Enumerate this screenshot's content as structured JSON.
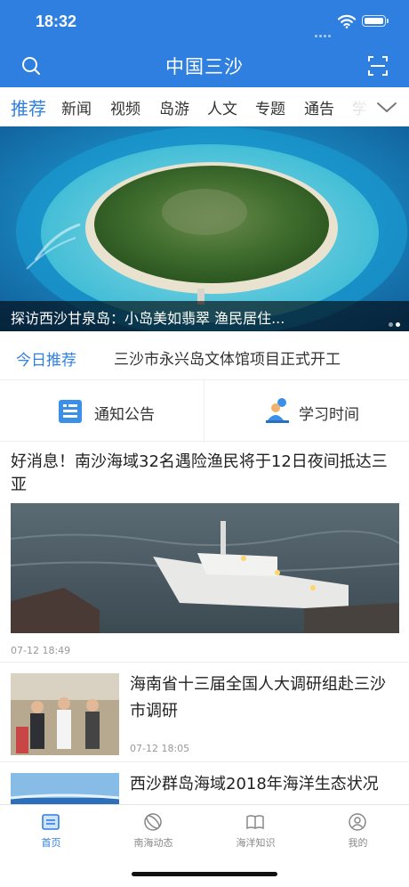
{
  "status_bar": {
    "time": "18:32"
  },
  "header": {
    "title": "中国三沙"
  },
  "tabs": [
    {
      "label": "推荐",
      "active": true
    },
    {
      "label": "新闻"
    },
    {
      "label": "视频"
    },
    {
      "label": "岛游"
    },
    {
      "label": "人文"
    },
    {
      "label": "专题"
    },
    {
      "label": "通告"
    },
    {
      "label": "学"
    }
  ],
  "banner": {
    "caption": "探访西沙甘泉岛：小岛美如翡翠 渔民居住..."
  },
  "today": {
    "label": "今日推荐",
    "headline": "三沙市永兴岛文体馆项目正式开工"
  },
  "shortcuts": [
    {
      "label": "通知公告",
      "icon": "notice-icon"
    },
    {
      "label": "学习时间",
      "icon": "study-icon"
    }
  ],
  "lead_article": {
    "headline": "好消息！南沙海域32名遇险渔民将于12日夜间抵达三亚",
    "time": "07-12 18:49"
  },
  "articles": [
    {
      "headline": "海南省十三届全国人大调研组赴三沙市调研",
      "time": "07-12 18:05"
    },
    {
      "headline": "西沙群岛海域2018年海洋生态状况"
    }
  ],
  "tabbar": [
    {
      "label": "首页",
      "icon": "home-icon",
      "active": true
    },
    {
      "label": "南海动态",
      "icon": "news-icon"
    },
    {
      "label": "海洋知识",
      "icon": "book-icon"
    },
    {
      "label": "我的",
      "icon": "profile-icon"
    }
  ],
  "colors": {
    "brand": "#2f7fe0",
    "text": "#222222",
    "muted": "#999999"
  }
}
